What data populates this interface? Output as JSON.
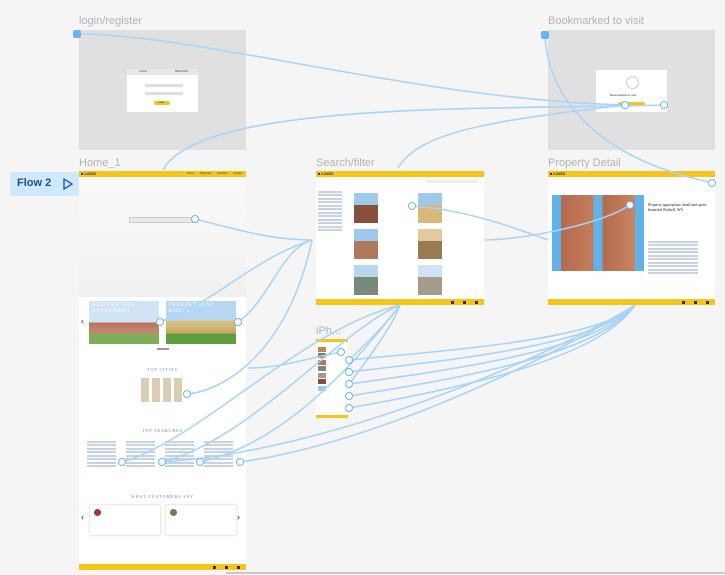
{
  "frames": {
    "login": {
      "label": "login/register",
      "tab_login": "LOGIN",
      "tab_register": "REGISTER",
      "button": "LOGIN"
    },
    "bookmarked": {
      "label": "Bookmarked to visit",
      "message": "Bookmarked to visit"
    },
    "home": {
      "label": "Home_1",
      "logo": "■ LOGO",
      "nav": [
        "Home",
        "Properties",
        "Favorites",
        "Contact"
      ],
      "slide1": "RESIDENTIAL APARTMENT",
      "slide2": "INDEPENDENT HOUSE",
      "top_cities": "TOP CITIES",
      "top_searches": "TOP SEARCHES",
      "testimonials": "WHAT CUSTOMERS SAY"
    },
    "search": {
      "label": "Search/filter",
      "logo": "■ LOGO"
    },
    "property": {
      "label": "Property Detail",
      "logo": "■ LOGO",
      "title": "Property appropriate small and quite beautiful Bothell, WA"
    },
    "iphone": {
      "label": "iPh..."
    }
  },
  "flow": {
    "label": "Flow 2",
    "icon": "play-outline-icon"
  },
  "colors": {
    "accent": "#f5c518",
    "connector": "#6ab4f5",
    "frame_label": "#b3b3b3",
    "gray_frame": "#e0e0e0"
  }
}
